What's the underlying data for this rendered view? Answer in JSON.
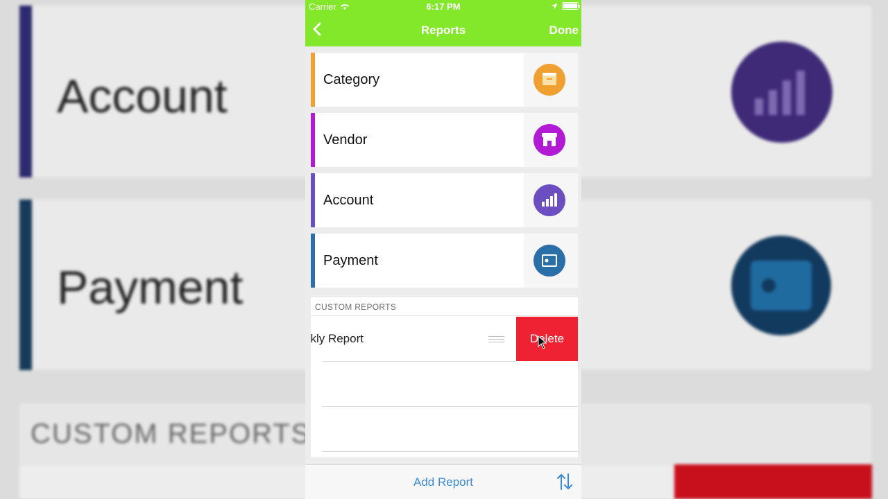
{
  "status_bar": {
    "carrier": "Carrier",
    "time": "6:17 PM"
  },
  "nav": {
    "title": "Reports",
    "done_label": "Done"
  },
  "reports": [
    {
      "label": "Category",
      "color": "#f0a030",
      "icon": "archive-box-icon"
    },
    {
      "label": "Vendor",
      "color": "#b21ad6",
      "icon": "storefront-icon"
    },
    {
      "label": "Account",
      "color": "#6b4fc0",
      "icon": "bar-chart-icon"
    },
    {
      "label": "Payment",
      "color": "#2a6fa8",
      "icon": "wallet-card-icon"
    }
  ],
  "custom_reports": {
    "header": "CUSTOM REPORTS",
    "items": [
      {
        "name": "ekly Report"
      }
    ],
    "delete_label": "Delete"
  },
  "toolbar": {
    "add_label": "Add Report"
  },
  "background": {
    "account_label": "Account",
    "payment_label": "Payment",
    "custom_label": "CUSTOM REPORTS"
  }
}
